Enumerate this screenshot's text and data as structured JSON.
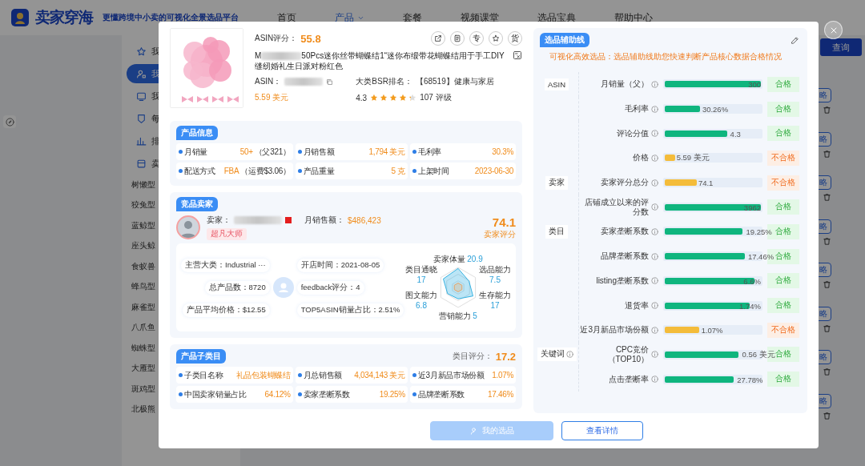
{
  "header": {
    "logo": "卖家穿海",
    "tagline": "更懂跨境中小卖的可视化全景选品平台",
    "nav": [
      {
        "label": "首页",
        "selected": false,
        "has_menu": false
      },
      {
        "label": "产品",
        "selected": true,
        "has_menu": true
      },
      {
        "label": "套餐",
        "selected": false,
        "has_menu": false
      },
      {
        "label": "视频课堂",
        "selected": false,
        "has_menu": false
      },
      {
        "label": "选品宝典",
        "selected": false,
        "has_menu": false
      },
      {
        "label": "帮助中心",
        "selected": false,
        "has_menu": false
      }
    ]
  },
  "sidebar": {
    "menu": [
      {
        "label": "我",
        "selected": false
      },
      {
        "label": "我",
        "selected": true
      },
      {
        "label": "我",
        "selected": false
      },
      {
        "label": "每",
        "selected": false
      },
      {
        "label": "排",
        "selected": false
      },
      {
        "label": "卖",
        "selected": false
      }
    ],
    "categories": [
      "树懒型",
      "狡兔型",
      "蓝鲸型",
      "座头鲸",
      "食蚁兽",
      "蜂鸟型",
      "麻雀型",
      "八爪鱼",
      "蜘蛛型",
      "大雁型",
      "斑鸡型",
      "北极熊"
    ]
  },
  "main": {
    "query_button": "查询",
    "row_buttons": [
      "略",
      "略",
      "略",
      "略",
      "略",
      "略",
      "略",
      "略"
    ]
  },
  "modal": {
    "product": {
      "score_label": "ASIN评分：",
      "score": "55.8",
      "title_start": "M",
      "title_rest": "50Pcs迷你丝带蝴蝶结1“迷你布缎带花蝴蝶结用于手工DIY缝纫婚礼生日派对粉红色",
      "asin_label": "ASIN：",
      "price": "5.59 美元",
      "bsr_label": "大类BSR排名：",
      "bsr_value": "【68519】健康与家居",
      "rating": "4.3",
      "stars": 4.3,
      "reviews": "107 评级",
      "actions": [
        {
          "kind": "share"
        },
        {
          "kind": "document"
        },
        {
          "kind": "text",
          "label": "专"
        },
        {
          "kind": "star"
        },
        {
          "kind": "text",
          "label": "货"
        }
      ]
    },
    "product_info": {
      "title": "产品信息",
      "items": [
        {
          "label": "月销量",
          "value": "50+",
          "note": "（父321）"
        },
        {
          "label": "月销售额",
          "value": "1,794 美元"
        },
        {
          "label": "毛利率",
          "value": "30.3%"
        },
        {
          "label": "配送方式",
          "value": "FBA",
          "note": "（运费$3.06）"
        },
        {
          "label": "产品重量",
          "value": "5 克"
        },
        {
          "label": "上架时间",
          "value": "2023-06-30"
        }
      ]
    },
    "seller": {
      "title": "竞品卖家",
      "seller_label": "卖家：",
      "sales_label": "月销售额：",
      "sales": "$486,423",
      "badge": "超凡大师",
      "score": "74.1",
      "score_label": "卖家评分",
      "stats_left": [
        "主营大类：Industrial ···",
        "总产品数：8720",
        "产品平均价格：$12.55"
      ],
      "stats_right": [
        "开店时间：2021-08-05",
        "feedback评分：4",
        "TOP5ASIN销量占比：2.51%"
      ],
      "radar": [
        {
          "label": "卖家体量",
          "value": "20.9"
        },
        {
          "label": "类目通晓",
          "value": "17"
        },
        {
          "label": "选品能力",
          "value": "7.5"
        },
        {
          "label": "图文能力",
          "value": "6.8"
        },
        {
          "label": "生存能力",
          "value": "17"
        },
        {
          "label": "营销能力",
          "value": "5"
        }
      ]
    },
    "subcategory": {
      "title": "产品子类目",
      "score_label": "类目评分：",
      "score": "17.2",
      "items": [
        {
          "label": "子类目名称",
          "value": "礼品包装蝴蝶结"
        },
        {
          "label": "月总销售额",
          "value": "4,034,143 美元"
        },
        {
          "label": "近3月新品市场份额",
          "value": "1.07%"
        },
        {
          "label": "中国卖家销量占比",
          "value": "64.12%"
        },
        {
          "label": "卖家垄断系数",
          "value": "19.25%"
        },
        {
          "label": "品牌垄断系数",
          "value": "17.46%"
        }
      ]
    },
    "guide": {
      "title": "选品辅助线",
      "subtitle": "可视化高效选品：选品辅助线助您快速判断产品核心数据合格情况",
      "groups": [
        {
          "label": "ASIN",
          "info": false,
          "rows": [
            {
              "label": "月销量（父）",
              "level": 1,
              "value": "300",
              "passed": true,
              "status": "合格"
            },
            {
              "label": "毛利率",
              "level": 0.37,
              "value": "30.26%",
              "passed": true,
              "status": "合格"
            },
            {
              "label": "评论分值",
              "level": 0.65,
              "value": "4.3",
              "passed": true,
              "status": "合格"
            },
            {
              "label": "价格",
              "level": 0.11,
              "value": "5.59 美元",
              "passed": false,
              "status": "不合格"
            }
          ]
        },
        {
          "label": "卖家",
          "info": false,
          "rows": [
            {
              "label": "卖家评分总分",
              "level": 0.33,
              "value": "74.1",
              "passed": false,
              "status": "不合格"
            },
            {
              "label": "店铺成立以来的评分数",
              "level": 1,
              "value": "3962",
              "passed": true,
              "status": "合格"
            }
          ]
        },
        {
          "label": "类目",
          "info": false,
          "rows": [
            {
              "label": "卖家垄断系数",
              "level": 0.81,
              "value": "19.25%",
              "passed": true,
              "status": "合格"
            },
            {
              "label": "品牌垄断系数",
              "level": 0.83,
              "value": "17.46%",
              "passed": true,
              "status": "合格"
            },
            {
              "label": "listing垄断系数",
              "level": 0.93,
              "value": "6.6%",
              "passed": true,
              "status": "合格"
            },
            {
              "label": "退货率",
              "level": 0.88,
              "value": "1.74%",
              "passed": true,
              "status": "合格"
            },
            {
              "label": "近3月新品市场份额",
              "level": 0.36,
              "value": "1.07%",
              "passed": false,
              "status": "不合格"
            }
          ]
        },
        {
          "label": "关键词",
          "info": true,
          "rows": [
            {
              "label": "CPC竞价（TOP10）",
              "level": 0.77,
              "value": "0.56 美元",
              "passed": true,
              "status": "合格"
            },
            {
              "label": "点击垄断率",
              "level": 0.72,
              "value": "27.78%",
              "passed": true,
              "status": "合格"
            }
          ]
        }
      ]
    },
    "footer": [
      {
        "label": "我的选品",
        "kind": "primary",
        "disabled": true
      },
      {
        "label": "查看详情",
        "kind": "outline",
        "disabled": false
      }
    ]
  }
}
